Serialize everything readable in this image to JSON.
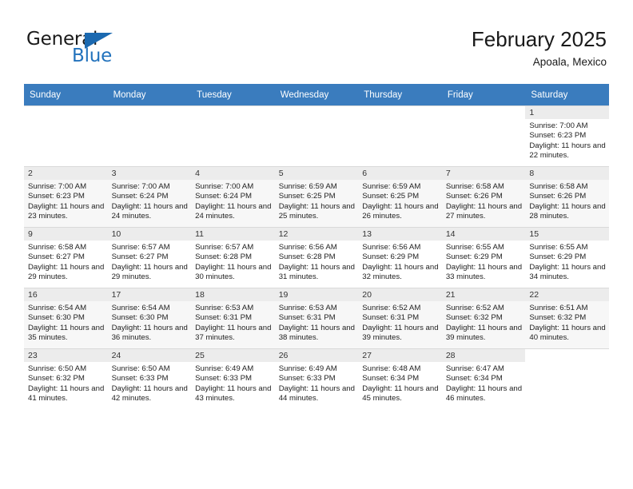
{
  "brand": {
    "name_part1": "General",
    "name_part2": "Blue",
    "flag_icon": "blue-triangle-flag-icon",
    "accent_color": "#2272bc"
  },
  "header": {
    "title": "February 2025",
    "subtitle": "Apoala, Mexico"
  },
  "calendar": {
    "header_bg": "#3a7cbe",
    "header_text_color": "#ffffff",
    "weekdays": [
      "Sunday",
      "Monday",
      "Tuesday",
      "Wednesday",
      "Thursday",
      "Friday",
      "Saturday"
    ],
    "weeks": [
      [
        {
          "day": "",
          "empty": true
        },
        {
          "day": "",
          "empty": true
        },
        {
          "day": "",
          "empty": true
        },
        {
          "day": "",
          "empty": true
        },
        {
          "day": "",
          "empty": true
        },
        {
          "day": "",
          "empty": true
        },
        {
          "day": "1",
          "sunrise": "Sunrise: 7:00 AM",
          "sunset": "Sunset: 6:23 PM",
          "daylight": "Daylight: 11 hours and 22 minutes."
        }
      ],
      [
        {
          "day": "2",
          "sunrise": "Sunrise: 7:00 AM",
          "sunset": "Sunset: 6:23 PM",
          "daylight": "Daylight: 11 hours and 23 minutes."
        },
        {
          "day": "3",
          "sunrise": "Sunrise: 7:00 AM",
          "sunset": "Sunset: 6:24 PM",
          "daylight": "Daylight: 11 hours and 24 minutes."
        },
        {
          "day": "4",
          "sunrise": "Sunrise: 7:00 AM",
          "sunset": "Sunset: 6:24 PM",
          "daylight": "Daylight: 11 hours and 24 minutes."
        },
        {
          "day": "5",
          "sunrise": "Sunrise: 6:59 AM",
          "sunset": "Sunset: 6:25 PM",
          "daylight": "Daylight: 11 hours and 25 minutes."
        },
        {
          "day": "6",
          "sunrise": "Sunrise: 6:59 AM",
          "sunset": "Sunset: 6:25 PM",
          "daylight": "Daylight: 11 hours and 26 minutes."
        },
        {
          "day": "7",
          "sunrise": "Sunrise: 6:58 AM",
          "sunset": "Sunset: 6:26 PM",
          "daylight": "Daylight: 11 hours and 27 minutes."
        },
        {
          "day": "8",
          "sunrise": "Sunrise: 6:58 AM",
          "sunset": "Sunset: 6:26 PM",
          "daylight": "Daylight: 11 hours and 28 minutes."
        }
      ],
      [
        {
          "day": "9",
          "sunrise": "Sunrise: 6:58 AM",
          "sunset": "Sunset: 6:27 PM",
          "daylight": "Daylight: 11 hours and 29 minutes."
        },
        {
          "day": "10",
          "sunrise": "Sunrise: 6:57 AM",
          "sunset": "Sunset: 6:27 PM",
          "daylight": "Daylight: 11 hours and 29 minutes."
        },
        {
          "day": "11",
          "sunrise": "Sunrise: 6:57 AM",
          "sunset": "Sunset: 6:28 PM",
          "daylight": "Daylight: 11 hours and 30 minutes."
        },
        {
          "day": "12",
          "sunrise": "Sunrise: 6:56 AM",
          "sunset": "Sunset: 6:28 PM",
          "daylight": "Daylight: 11 hours and 31 minutes."
        },
        {
          "day": "13",
          "sunrise": "Sunrise: 6:56 AM",
          "sunset": "Sunset: 6:29 PM",
          "daylight": "Daylight: 11 hours and 32 minutes."
        },
        {
          "day": "14",
          "sunrise": "Sunrise: 6:55 AM",
          "sunset": "Sunset: 6:29 PM",
          "daylight": "Daylight: 11 hours and 33 minutes."
        },
        {
          "day": "15",
          "sunrise": "Sunrise: 6:55 AM",
          "sunset": "Sunset: 6:29 PM",
          "daylight": "Daylight: 11 hours and 34 minutes."
        }
      ],
      [
        {
          "day": "16",
          "sunrise": "Sunrise: 6:54 AM",
          "sunset": "Sunset: 6:30 PM",
          "daylight": "Daylight: 11 hours and 35 minutes."
        },
        {
          "day": "17",
          "sunrise": "Sunrise: 6:54 AM",
          "sunset": "Sunset: 6:30 PM",
          "daylight": "Daylight: 11 hours and 36 minutes."
        },
        {
          "day": "18",
          "sunrise": "Sunrise: 6:53 AM",
          "sunset": "Sunset: 6:31 PM",
          "daylight": "Daylight: 11 hours and 37 minutes."
        },
        {
          "day": "19",
          "sunrise": "Sunrise: 6:53 AM",
          "sunset": "Sunset: 6:31 PM",
          "daylight": "Daylight: 11 hours and 38 minutes."
        },
        {
          "day": "20",
          "sunrise": "Sunrise: 6:52 AM",
          "sunset": "Sunset: 6:31 PM",
          "daylight": "Daylight: 11 hours and 39 minutes."
        },
        {
          "day": "21",
          "sunrise": "Sunrise: 6:52 AM",
          "sunset": "Sunset: 6:32 PM",
          "daylight": "Daylight: 11 hours and 39 minutes."
        },
        {
          "day": "22",
          "sunrise": "Sunrise: 6:51 AM",
          "sunset": "Sunset: 6:32 PM",
          "daylight": "Daylight: 11 hours and 40 minutes."
        }
      ],
      [
        {
          "day": "23",
          "sunrise": "Sunrise: 6:50 AM",
          "sunset": "Sunset: 6:32 PM",
          "daylight": "Daylight: 11 hours and 41 minutes."
        },
        {
          "day": "24",
          "sunrise": "Sunrise: 6:50 AM",
          "sunset": "Sunset: 6:33 PM",
          "daylight": "Daylight: 11 hours and 42 minutes."
        },
        {
          "day": "25",
          "sunrise": "Sunrise: 6:49 AM",
          "sunset": "Sunset: 6:33 PM",
          "daylight": "Daylight: 11 hours and 43 minutes."
        },
        {
          "day": "26",
          "sunrise": "Sunrise: 6:49 AM",
          "sunset": "Sunset: 6:33 PM",
          "daylight": "Daylight: 11 hours and 44 minutes."
        },
        {
          "day": "27",
          "sunrise": "Sunrise: 6:48 AM",
          "sunset": "Sunset: 6:34 PM",
          "daylight": "Daylight: 11 hours and 45 minutes."
        },
        {
          "day": "28",
          "sunrise": "Sunrise: 6:47 AM",
          "sunset": "Sunset: 6:34 PM",
          "daylight": "Daylight: 11 hours and 46 minutes."
        },
        {
          "day": "",
          "empty": true
        }
      ]
    ]
  }
}
